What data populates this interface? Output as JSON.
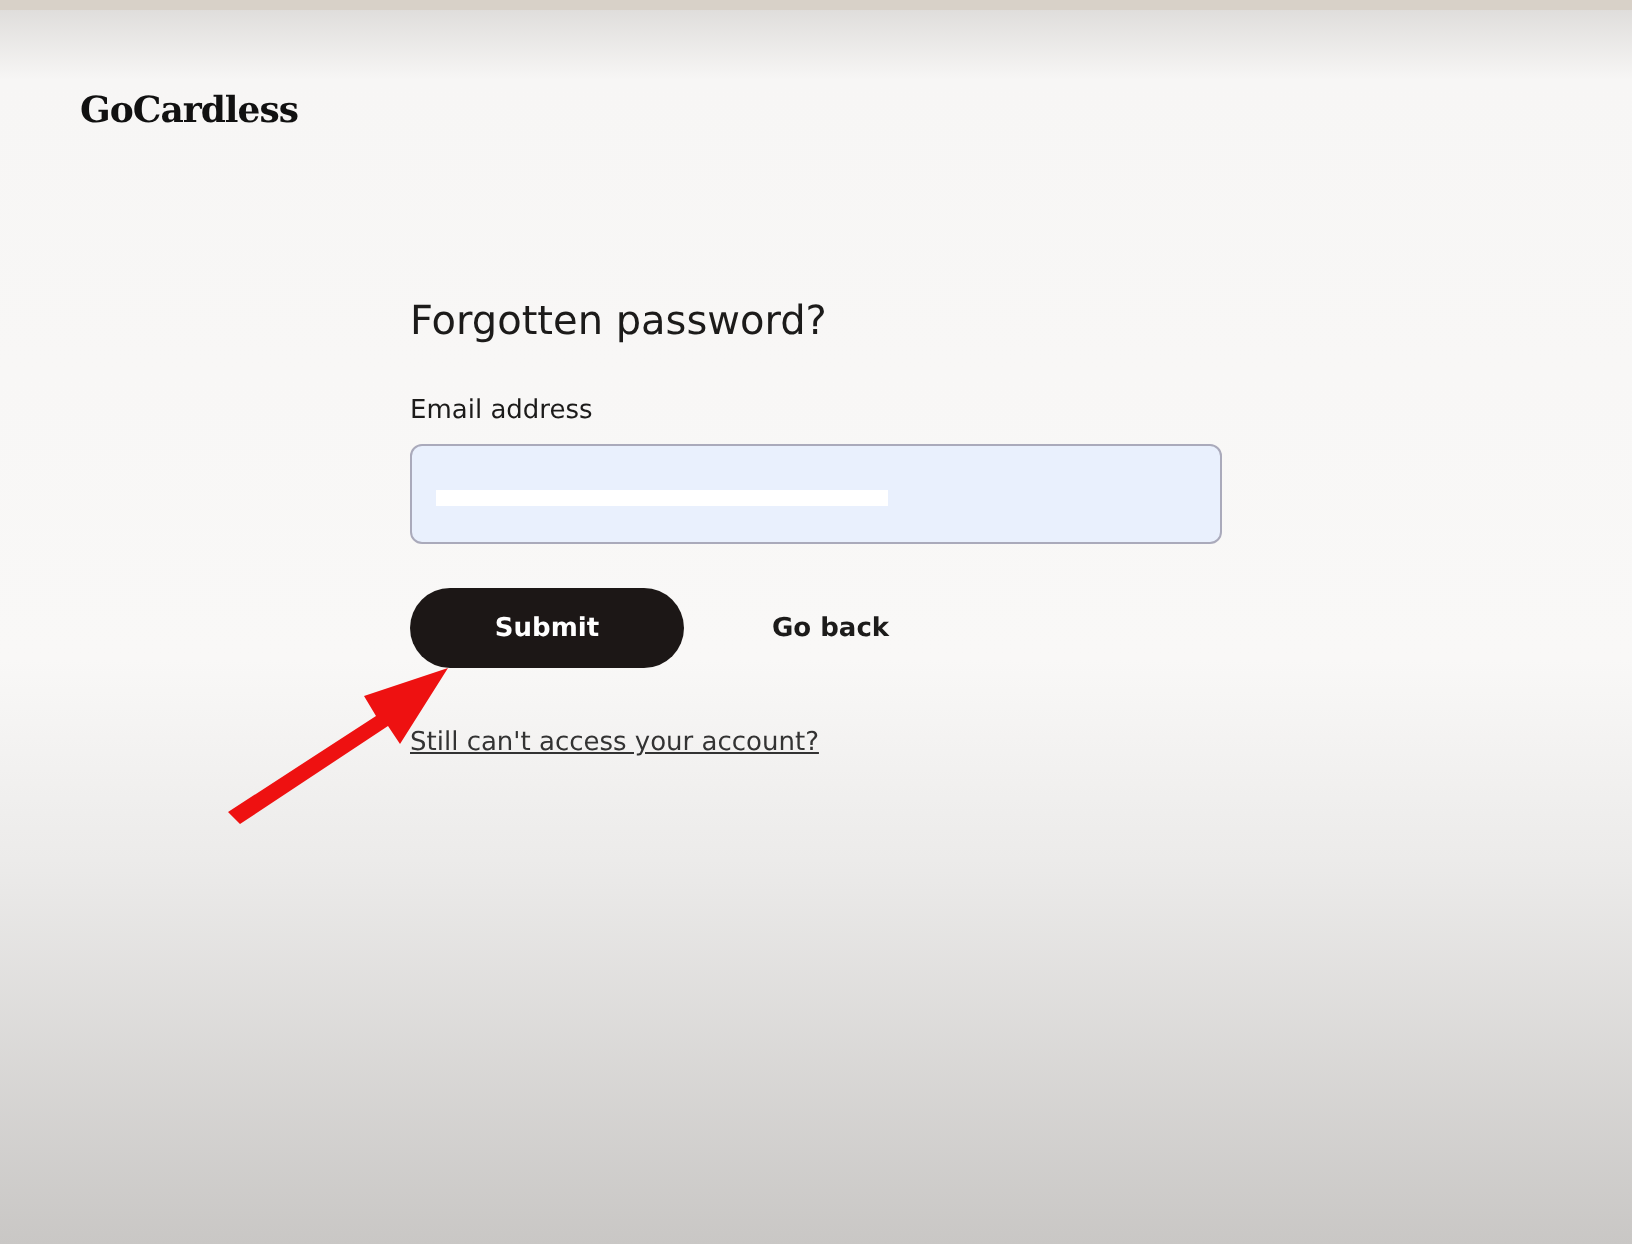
{
  "logo": "GoCardless",
  "form": {
    "title": "Forgotten password?",
    "email_label": "Email address",
    "submit": "Submit",
    "back": "Go back",
    "help_link": "Still can't access your account?"
  }
}
